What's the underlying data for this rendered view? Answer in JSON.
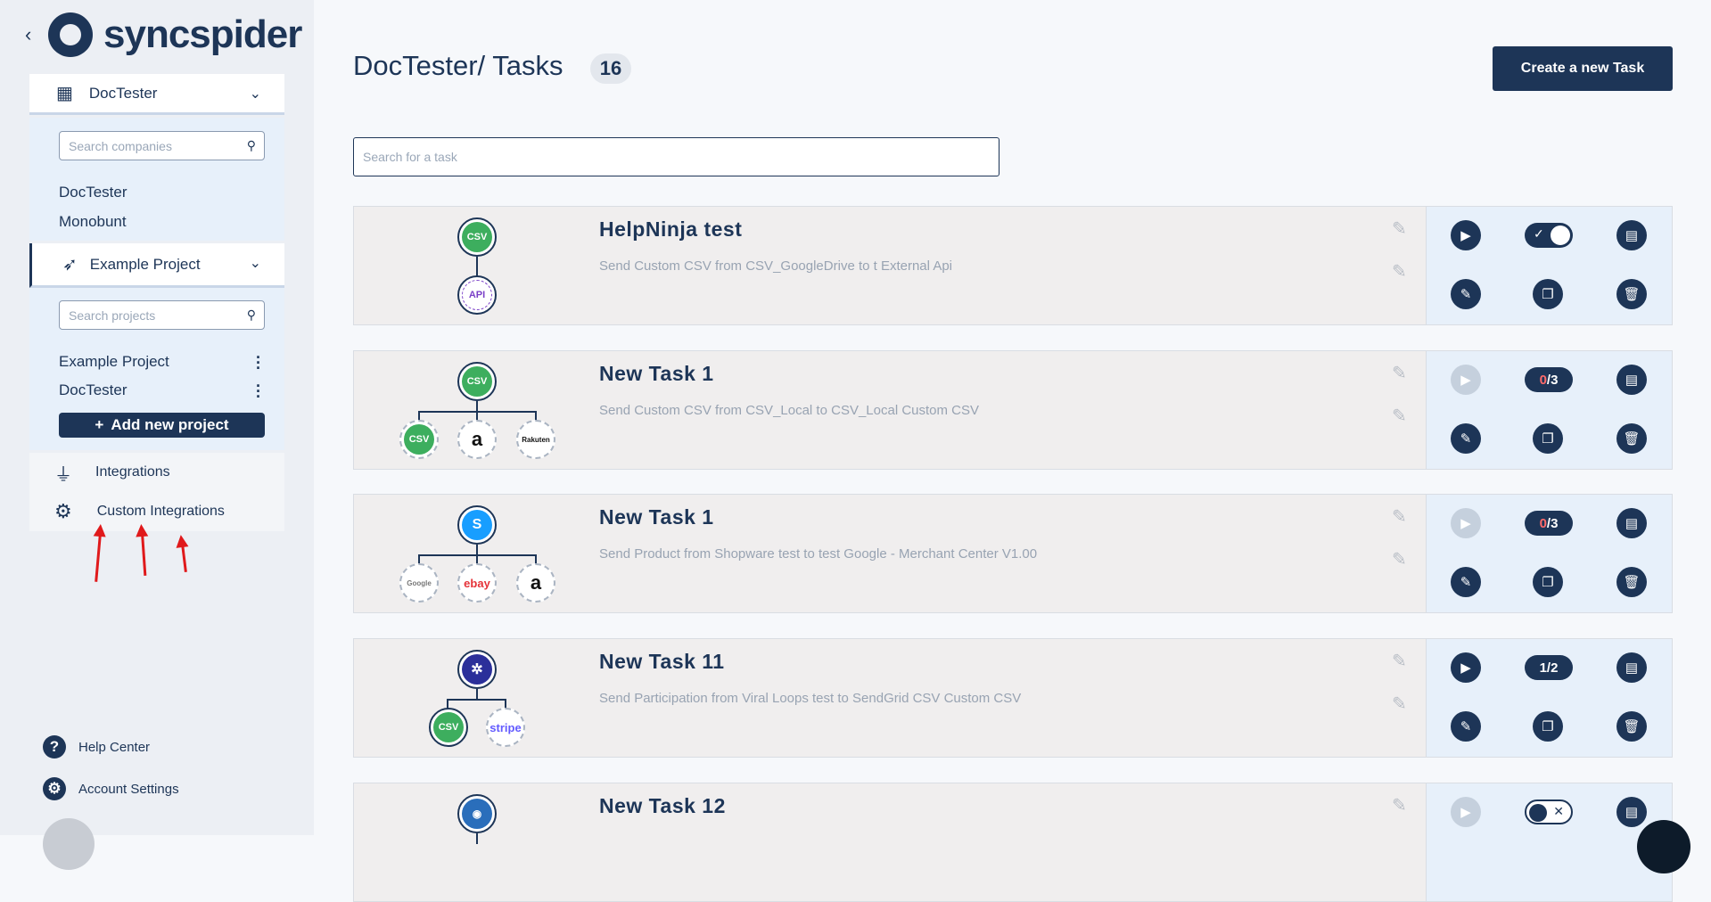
{
  "sidebar": {
    "logo": "syncspider",
    "company": {
      "selected": "DocTester",
      "search_placeholder": "Search companies",
      "items": [
        "DocTester",
        "Monobunt"
      ]
    },
    "project": {
      "selected": "Example Project",
      "search_placeholder": "Search projects",
      "items": [
        "Example Project",
        "DocTester"
      ],
      "add_label": "Add new project"
    },
    "nav": {
      "integrations": "Integrations",
      "custom_integrations": "Custom Integrations"
    },
    "bottom": {
      "help": "Help Center",
      "account": "Account Settings"
    }
  },
  "header": {
    "title": "DocTester/ Tasks",
    "count": "16",
    "create_label": "Create a new Task"
  },
  "search": {
    "placeholder": "Search for a task"
  },
  "tasks": [
    {
      "title": "HelpNinja test",
      "desc": "Send Custom CSV from CSV_GoogleDrive to t External Api",
      "status": "toggle-on"
    },
    {
      "title": "New Task 1",
      "desc": "Send Custom CSV from CSV_Local to CSV_Local Custom CSV",
      "status": "0/3",
      "runs_done": "0",
      "runs_total": "/3"
    },
    {
      "title": "New Task 1",
      "desc": "Send Product from Shopware test to test Google - Merchant Center V1.00",
      "status": "0/3",
      "runs_done": "0",
      "runs_total": "/3"
    },
    {
      "title": "New Task 11",
      "desc": "Send Participation from Viral Loops test to SendGrid CSV Custom CSV",
      "status": "1/2"
    },
    {
      "title": "New Task 12",
      "desc": "",
      "status": "toggle-off"
    }
  ],
  "node_labels": {
    "csv": "CSV",
    "api": "API",
    "amazon": "a",
    "rakuten": "Rakuten",
    "google": "Google",
    "ebay": "ebay",
    "stripe": "stripe"
  },
  "colors": {
    "primary": "#1d3557",
    "csv_green": "#3dae5e",
    "arrow_red": "#e0191b"
  }
}
